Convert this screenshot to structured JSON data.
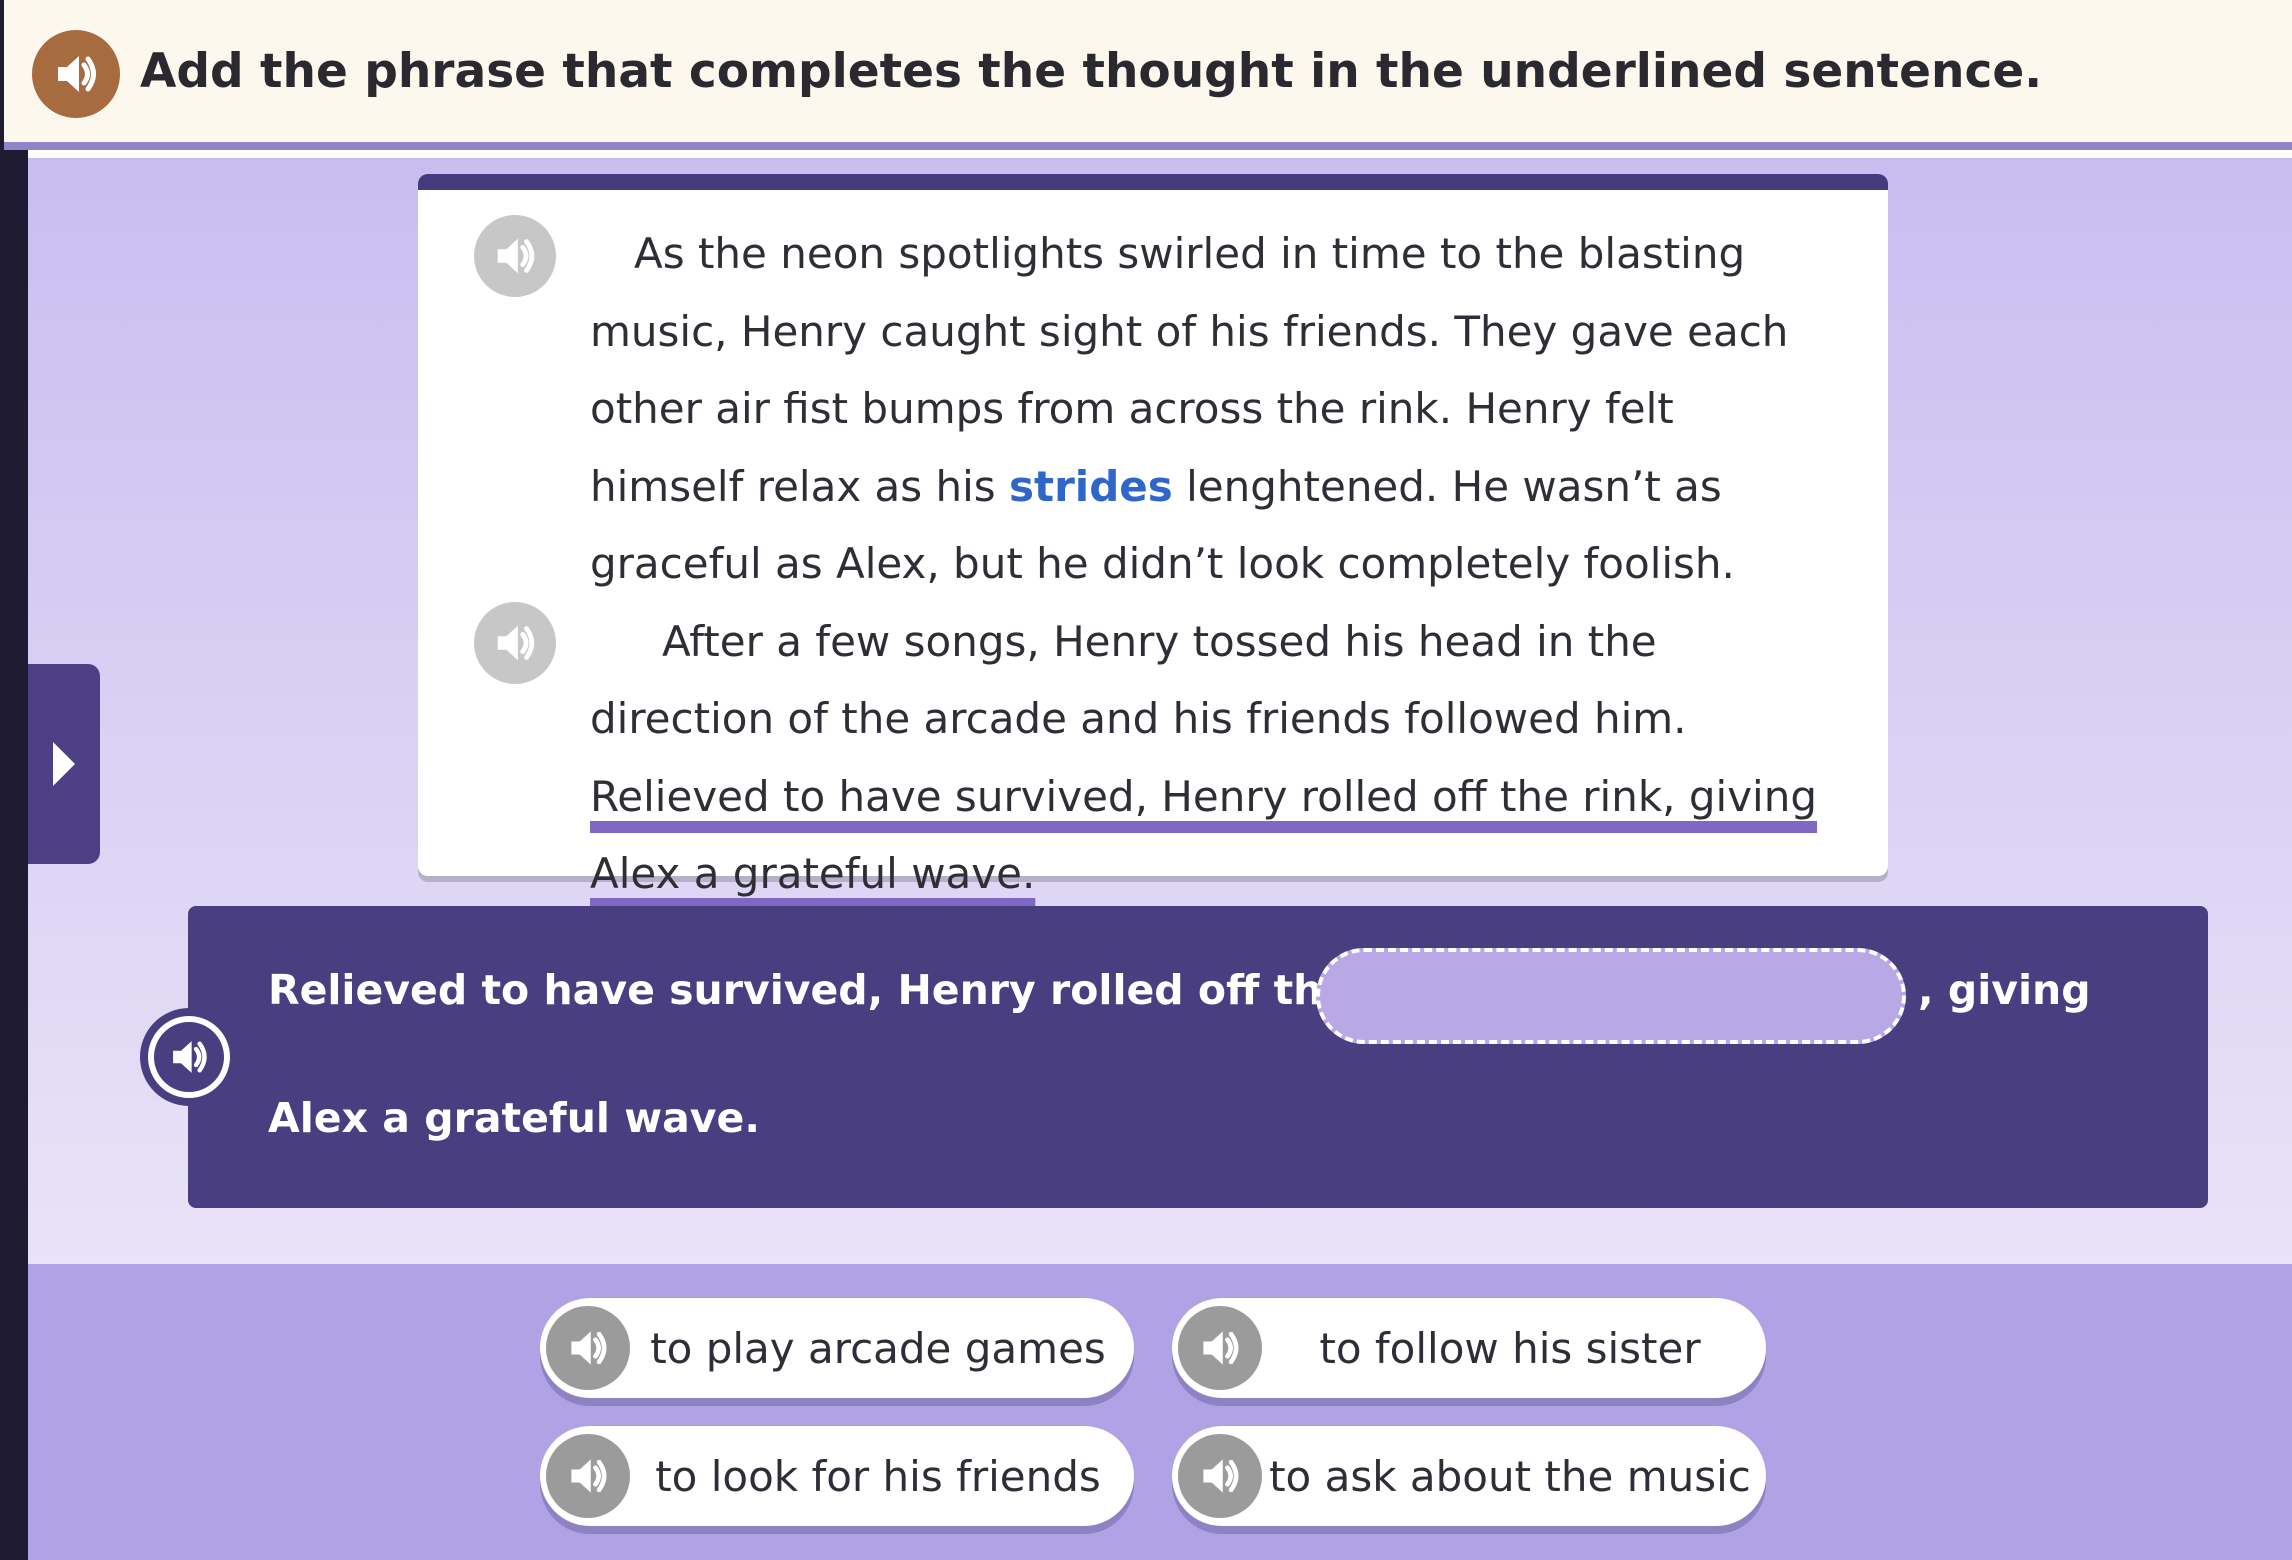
{
  "header": {
    "title": "Add the phrase that completes the thought in the underlined sentence.",
    "speaker_icon": "speaker-icon",
    "accent_color": "#a66b3e"
  },
  "side_tab": {
    "icon": "play-arrow-icon"
  },
  "passage": {
    "paragraph1": {
      "before_vocab": "As the neon spotlights swirled in time to the blasting music, Henry caught sight of his friends. They gave each other air fist bumps from across the rink. Henry felt himself relax as his ",
      "vocab_word": "strides",
      "after_vocab": " lenghtened. He wasn’t as graceful as Alex, but he didn’t look completely foolish."
    },
    "paragraph2": {
      "plain": "After a few songs, Henry tossed his head in the direction of the arcade and his friends followed him. ",
      "underlined": "Relieved to have survived, Henry rolled off the rink, giving Alex a grateful wave."
    }
  },
  "sentence": {
    "part1": "Relieved to have survived, Henry rolled off the rink",
    "part2": ", giving",
    "part3": "Alex a grateful wave."
  },
  "choices": [
    {
      "label": "to play arcade games"
    },
    {
      "label": "to follow his sister"
    },
    {
      "label": "to look for his friends"
    },
    {
      "label": "to ask about the music"
    }
  ],
  "colors": {
    "vocab": "#2f66c9",
    "underline": "#7f68c4",
    "sentence_box": "#493e80",
    "answers_bg": "#b1a2e6"
  }
}
